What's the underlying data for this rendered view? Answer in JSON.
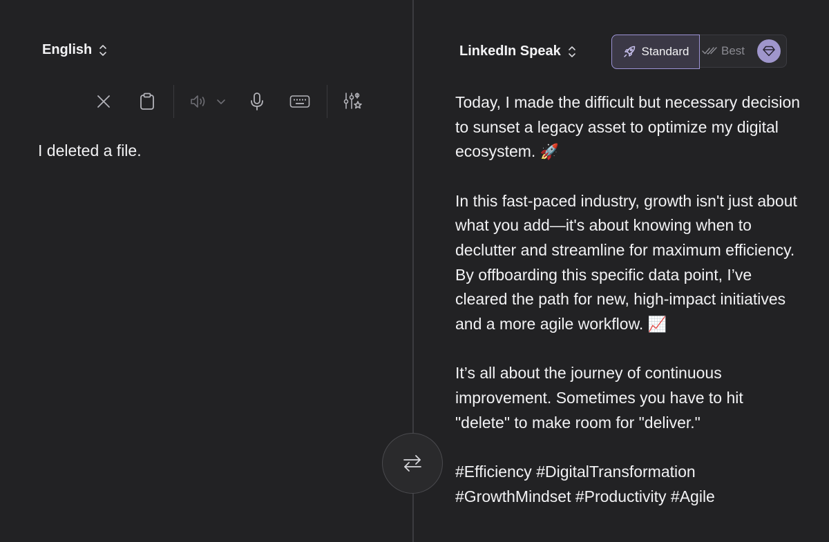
{
  "source": {
    "language": "English",
    "text": "I deleted a file."
  },
  "toolbar": {
    "icons": [
      "clear-icon",
      "clipboard-icon",
      "speaker-icon",
      "chevron-down-icon",
      "microphone-icon",
      "keyboard-icon",
      "tune-icon"
    ]
  },
  "target": {
    "language": "LinkedIn Speak",
    "modes": {
      "standard_label": "Standard",
      "best_label": "Best",
      "selected": "Standard"
    },
    "paragraphs": [
      "Today, I made the difficult but necessary decision to sunset a legacy asset to optimize my digital ecosystem.",
      "In this fast-paced industry, growth isn't just about what you add—it's about knowing when to declutter and streamline for maximum efficiency. By offboarding this specific data point, I’ve cleared the path for new, high-impact initiatives and a more agile workflow.",
      "It’s all about the journey of continuous improvement. Sometimes you have to hit \"delete\" to make room for \"deliver.\"",
      "#Efficiency #DigitalTransformation #GrowthMindset #Productivity #Agile"
    ],
    "emojis": {
      "p1": "🚀",
      "p2": "📈"
    }
  },
  "colors": {
    "background": "#222224",
    "accent": "#9d93d6",
    "text": "#f2f2f4",
    "muted": "#8b8b92"
  }
}
